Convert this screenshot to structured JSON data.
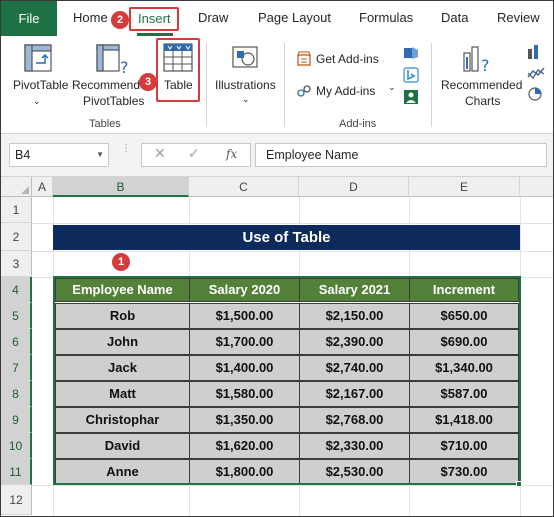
{
  "ribbon": {
    "tabs": [
      "File",
      "Home",
      "Insert",
      "Draw",
      "Page Layout",
      "Formulas",
      "Data",
      "Review"
    ],
    "active_tab": "Insert",
    "buttons": {
      "pivot_table": "PivotTable",
      "recommended_pivot_line1": "Recommended",
      "recommended_pivot_line2": "PivotTables",
      "table": "Table",
      "illustrations": "Illustrations",
      "get_addins": "Get Add-ins",
      "my_addins": "My Add-ins",
      "recommended_charts_line1": "Recommended",
      "recommended_charts_line2": "Charts"
    },
    "groups": {
      "tables": "Tables",
      "addins": "Add-ins"
    }
  },
  "callouts": {
    "one": "1",
    "two": "2",
    "three": "3"
  },
  "formula_bar": {
    "name_box": "B4",
    "fx_label": "fx",
    "formula": "Employee Name"
  },
  "sheet": {
    "columns": [
      "A",
      "B",
      "C",
      "D",
      "E"
    ],
    "rows": [
      "1",
      "2",
      "3",
      "4",
      "5",
      "6",
      "7",
      "8",
      "9",
      "10",
      "11",
      "12"
    ],
    "title": "Use of Table",
    "table": {
      "headers": [
        "Employee Name",
        "Salary 2020",
        "Salary 2021",
        "Increment"
      ],
      "rows": [
        [
          "Rob",
          "$1,500.00",
          "$2,150.00",
          "$650.00"
        ],
        [
          "John",
          "$1,700.00",
          "$2,390.00",
          "$690.00"
        ],
        [
          "Jack",
          "$1,400.00",
          "$2,740.00",
          "$1,340.00"
        ],
        [
          "Matt",
          "$1,580.00",
          "$2,167.00",
          "$587.00"
        ],
        [
          "Christophar",
          "$1,350.00",
          "$2,768.00",
          "$1,418.00"
        ],
        [
          "David",
          "$1,620.00",
          "$2,330.00",
          "$710.00"
        ],
        [
          "Anne",
          "$1,800.00",
          "$2,530.00",
          "$730.00"
        ]
      ]
    }
  },
  "colors": {
    "excel_green": "#1e7145",
    "title_fill": "#0d2a5c",
    "header_fill": "#53813a",
    "body_fill": "#cfcfcf",
    "callout_red": "#d63b3b"
  }
}
